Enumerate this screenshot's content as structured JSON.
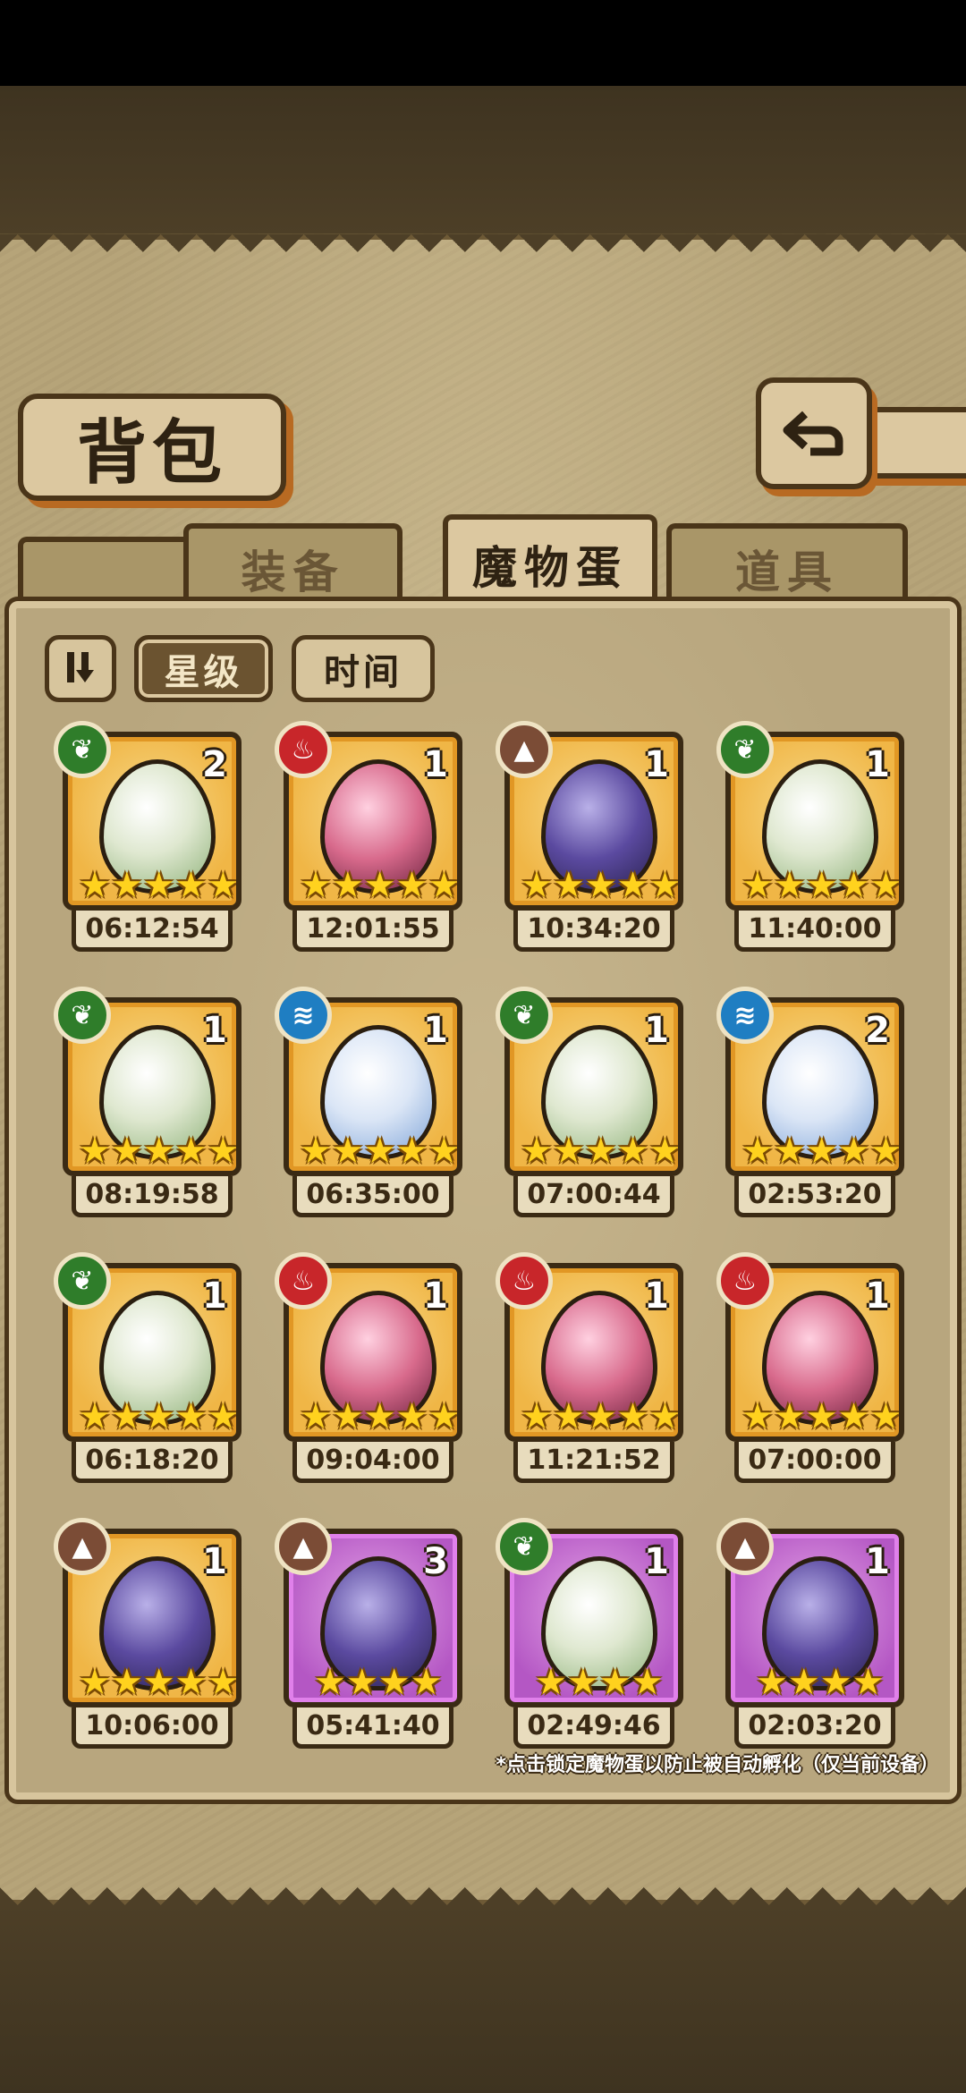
{
  "page_title": "背包",
  "back_icon": "back-arrow-icon",
  "tabs": [
    {
      "label": "装备",
      "active": false
    },
    {
      "label": "魔物蛋",
      "active": true
    },
    {
      "label": "道具",
      "active": false
    }
  ],
  "sort": {
    "order_icon": "sort-order-icon",
    "star_label": "星级",
    "time_label": "时间",
    "active": "星级"
  },
  "eggs": [
    {
      "element": "nature",
      "count": "2",
      "stars": 5,
      "timer": "06:12:54",
      "frame": "gold"
    },
    {
      "element": "fire",
      "count": "1",
      "stars": 5,
      "timer": "12:01:55",
      "frame": "gold"
    },
    {
      "element": "earth",
      "count": "1",
      "stars": 5,
      "timer": "10:34:20",
      "frame": "gold"
    },
    {
      "element": "nature",
      "count": "1",
      "stars": 5,
      "timer": "11:40:00",
      "frame": "gold"
    },
    {
      "element": "nature",
      "count": "1",
      "stars": 5,
      "timer": "08:19:58",
      "frame": "gold"
    },
    {
      "element": "water",
      "count": "1",
      "stars": 5,
      "timer": "06:35:00",
      "frame": "gold"
    },
    {
      "element": "nature",
      "count": "1",
      "stars": 5,
      "timer": "07:00:44",
      "frame": "gold"
    },
    {
      "element": "water",
      "count": "2",
      "stars": 5,
      "timer": "02:53:20",
      "frame": "gold"
    },
    {
      "element": "nature",
      "count": "1",
      "stars": 5,
      "timer": "06:18:20",
      "frame": "gold"
    },
    {
      "element": "fire",
      "count": "1",
      "stars": 5,
      "timer": "09:04:00",
      "frame": "gold"
    },
    {
      "element": "fire",
      "count": "1",
      "stars": 5,
      "timer": "11:21:52",
      "frame": "gold"
    },
    {
      "element": "fire",
      "count": "1",
      "stars": 5,
      "timer": "07:00:00",
      "frame": "gold"
    },
    {
      "element": "earth",
      "count": "1",
      "stars": 5,
      "timer": "10:06:00",
      "frame": "gold"
    },
    {
      "element": "earth",
      "count": "3",
      "stars": 4,
      "timer": "05:41:40",
      "frame": "purple"
    },
    {
      "element": "nature",
      "count": "1",
      "stars": 4,
      "timer": "02:49:46",
      "frame": "purple"
    },
    {
      "element": "earth",
      "count": "1",
      "stars": 4,
      "timer": "02:03:20",
      "frame": "purple"
    }
  ],
  "hint": "*点击锁定魔物蛋以防止被自动孵化（仅当前设备）",
  "colors": {
    "nature": "#2f7d2a",
    "fire": "#c8262a",
    "water": "#1f7ec2",
    "earth": "#7b4c36",
    "gold_frame": "#f0b646",
    "purple_frame": "#b457c4"
  }
}
